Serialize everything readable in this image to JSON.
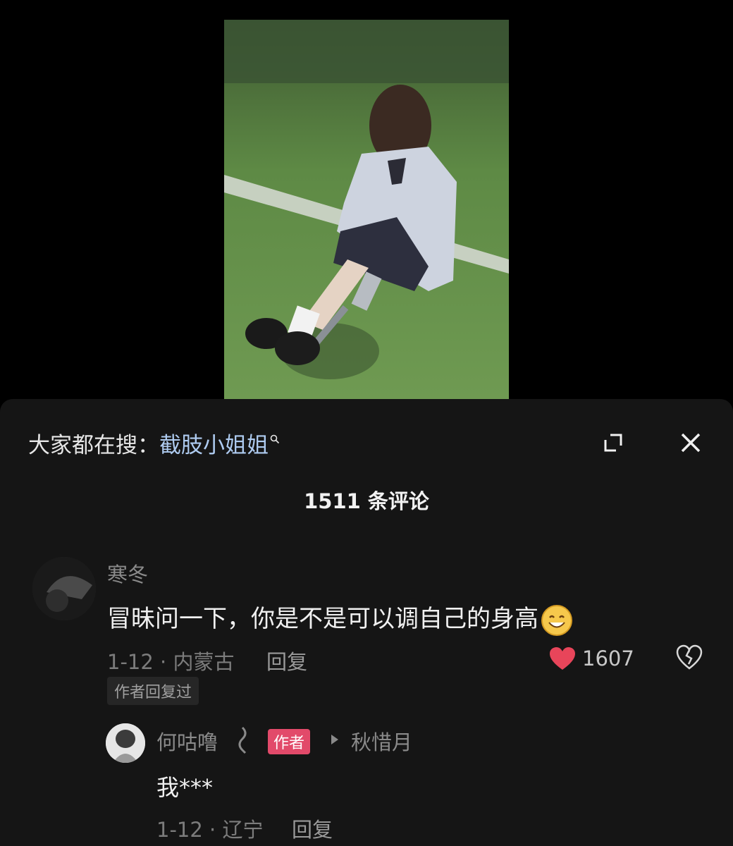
{
  "search_bar": {
    "prefix": "大家都在搜：",
    "term": "截肢小姐姐"
  },
  "comments_header": {
    "count_label": "1511 条评论"
  },
  "comments": [
    {
      "username": "寒冬",
      "text": "冒昧问一下，你是不是可以调自己的身高",
      "emoji": "smile-emoji",
      "meta": "1-12 · 内蒙古",
      "reply_label": "回复",
      "likes": "1607",
      "author_replied_tag": "作者回复过"
    }
  ],
  "reply": {
    "username": "何咕噜",
    "author_badge": "作者",
    "reply_to": "秋惜月",
    "text": "我***",
    "meta": "1-12 · 辽宁",
    "reply_label": "回复"
  },
  "colors": {
    "search_term": "#aecbf0",
    "like_heart": "#e8455a",
    "author_badge": "#e24a6a",
    "panel_bg": "#151515"
  },
  "icons": [
    "search-icon",
    "expand-icon",
    "close-icon",
    "heart-icon",
    "broken-heart-icon",
    "reply-arrow-icon"
  ]
}
